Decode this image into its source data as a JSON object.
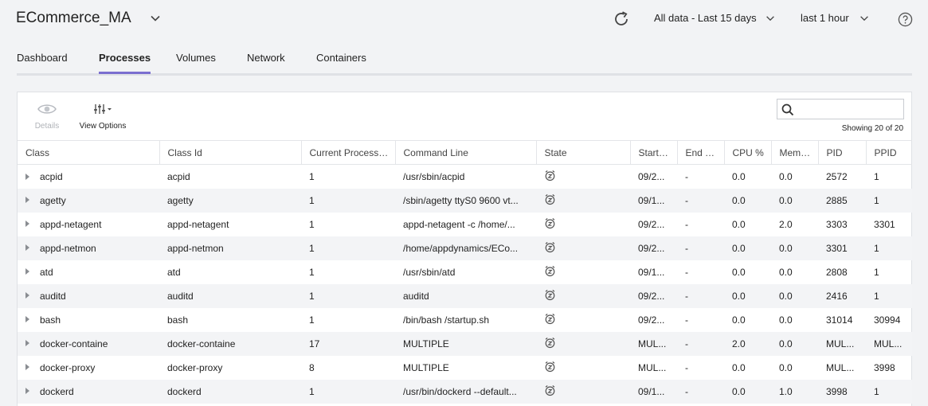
{
  "app": {
    "title": "ECommerce_MA"
  },
  "header": {
    "range_label": "All data - Last 15 days",
    "time_label": "last 1 hour"
  },
  "tabs": [
    {
      "label": "Dashboard",
      "active": false
    },
    {
      "label": "Processes",
      "active": true
    },
    {
      "label": "Volumes",
      "active": false
    },
    {
      "label": "Network",
      "active": false
    },
    {
      "label": "Containers",
      "active": false
    }
  ],
  "toolbar": {
    "details_label": "Details",
    "view_options_label": "View Options",
    "search_placeholder": "",
    "showing_text": "Showing 20 of 20"
  },
  "table": {
    "columns": [
      "Class",
      "Class Id",
      "Current Processes",
      "Command Line",
      "State",
      "Start Time",
      "End Time",
      "CPU %",
      "Memory %",
      "PID",
      "PPID"
    ],
    "rows": [
      {
        "class": "acpid",
        "class_id": "acpid",
        "current": "1",
        "command": "/usr/sbin/acpid",
        "state_icon": "sleep-icon",
        "start": "09/2...",
        "end": "-",
        "cpu": "0.0",
        "mem": "0.0",
        "pid": "2572",
        "ppid": "1"
      },
      {
        "class": "agetty",
        "class_id": "agetty",
        "current": "1",
        "command": "/sbin/agetty ttyS0 9600 vt...",
        "state_icon": "sleep-icon",
        "start": "09/1...",
        "end": "-",
        "cpu": "0.0",
        "mem": "0.0",
        "pid": "2885",
        "ppid": "1"
      },
      {
        "class": "appd-netagent",
        "class_id": "appd-netagent",
        "current": "1",
        "command": "appd-netagent -c /home/...",
        "state_icon": "sleep-icon",
        "start": "09/2...",
        "end": "-",
        "cpu": "0.0",
        "mem": "2.0",
        "pid": "3303",
        "ppid": "3301"
      },
      {
        "class": "appd-netmon",
        "class_id": "appd-netmon",
        "current": "1",
        "command": "/home/appdynamics/ECo...",
        "state_icon": "sleep-icon",
        "start": "09/2...",
        "end": "-",
        "cpu": "0.0",
        "mem": "0.0",
        "pid": "3301",
        "ppid": "1"
      },
      {
        "class": "atd",
        "class_id": "atd",
        "current": "1",
        "command": "/usr/sbin/atd",
        "state_icon": "sleep-icon",
        "start": "09/1...",
        "end": "-",
        "cpu": "0.0",
        "mem": "0.0",
        "pid": "2808",
        "ppid": "1"
      },
      {
        "class": "auditd",
        "class_id": "auditd",
        "current": "1",
        "command": "auditd",
        "state_icon": "sleep-icon",
        "start": "09/2...",
        "end": "-",
        "cpu": "0.0",
        "mem": "0.0",
        "pid": "2416",
        "ppid": "1"
      },
      {
        "class": "bash",
        "class_id": "bash",
        "current": "1",
        "command": "/bin/bash /startup.sh",
        "state_icon": "sleep-icon",
        "start": "09/2...",
        "end": "-",
        "cpu": "0.0",
        "mem": "0.0",
        "pid": "31014",
        "ppid": "30994"
      },
      {
        "class": "docker-containe",
        "class_id": "docker-containe",
        "current": "17",
        "command": "MULTIPLE",
        "state_icon": "sleep-icon",
        "start": "MUL...",
        "end": "-",
        "cpu": "2.0",
        "mem": "0.0",
        "pid": "MUL...",
        "ppid": "MUL..."
      },
      {
        "class": "docker-proxy",
        "class_id": "docker-proxy",
        "current": "8",
        "command": "MULTIPLE",
        "state_icon": "sleep-icon",
        "start": "MUL...",
        "end": "-",
        "cpu": "0.0",
        "mem": "0.0",
        "pid": "MUL...",
        "ppid": "3998"
      },
      {
        "class": "dockerd",
        "class_id": "dockerd",
        "current": "1",
        "command": "/usr/bin/dockerd --default...",
        "state_icon": "sleep-icon",
        "start": "09/1...",
        "end": "-",
        "cpu": "0.0",
        "mem": "1.0",
        "pid": "3998",
        "ppid": "1"
      }
    ]
  },
  "colors": {
    "accent": "#7b6fd0",
    "stripe": "#f3f4f6",
    "border": "#dfe1e5"
  }
}
